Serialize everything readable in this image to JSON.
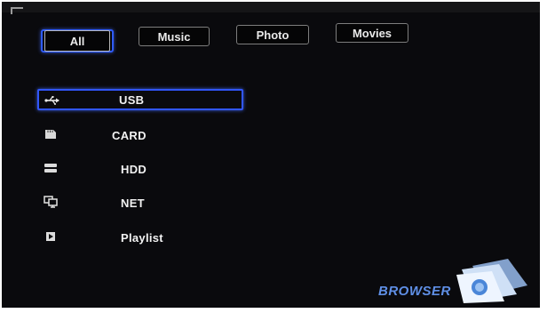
{
  "tabs": [
    {
      "label": "All",
      "active": true
    },
    {
      "label": "Music",
      "active": false
    },
    {
      "label": "Photo",
      "active": false
    },
    {
      "label": "Movies",
      "active": false
    }
  ],
  "devices": [
    {
      "label": "USB",
      "icon": "usb-icon",
      "selected": true
    },
    {
      "label": "CARD",
      "icon": "sd-card-icon",
      "selected": false
    },
    {
      "label": "HDD",
      "icon": "hard-drive-icon",
      "selected": false
    },
    {
      "label": "NET",
      "icon": "network-icon",
      "selected": false
    },
    {
      "label": "Playlist",
      "icon": "playlist-icon",
      "selected": false
    }
  ],
  "brand": {
    "text": "BROWSER",
    "icon": "browser-folder-logo"
  },
  "colors": {
    "accent": "#2f5cff",
    "background": "#0a0a0d",
    "text": "#f2f2f2",
    "brand_text": "#5f8fe6"
  }
}
